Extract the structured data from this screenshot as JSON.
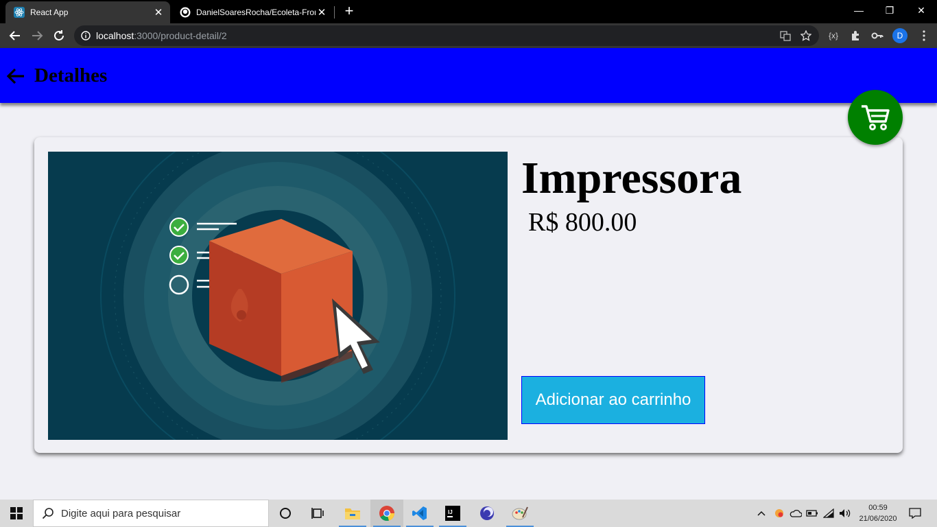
{
  "browser": {
    "tabs": [
      {
        "title": "React App"
      },
      {
        "title": "DanielSoaresRocha/Ecoleta-Front"
      }
    ],
    "url_host": "localhost",
    "url_path": ":3000/product-detail/2",
    "profile_initial": "D"
  },
  "app": {
    "header_title": "Detalhes",
    "product": {
      "name": "Impressora",
      "price": "R$ 800.00"
    },
    "add_to_cart_label": "Adicionar ao carrinho",
    "colors": {
      "header": "#0000ff",
      "cart_fab": "#008000",
      "button": "#1bb0e0"
    }
  },
  "taskbar": {
    "search_placeholder": "Digite aqui para pesquisar",
    "time": "00:59",
    "date": "21/06/2020"
  }
}
